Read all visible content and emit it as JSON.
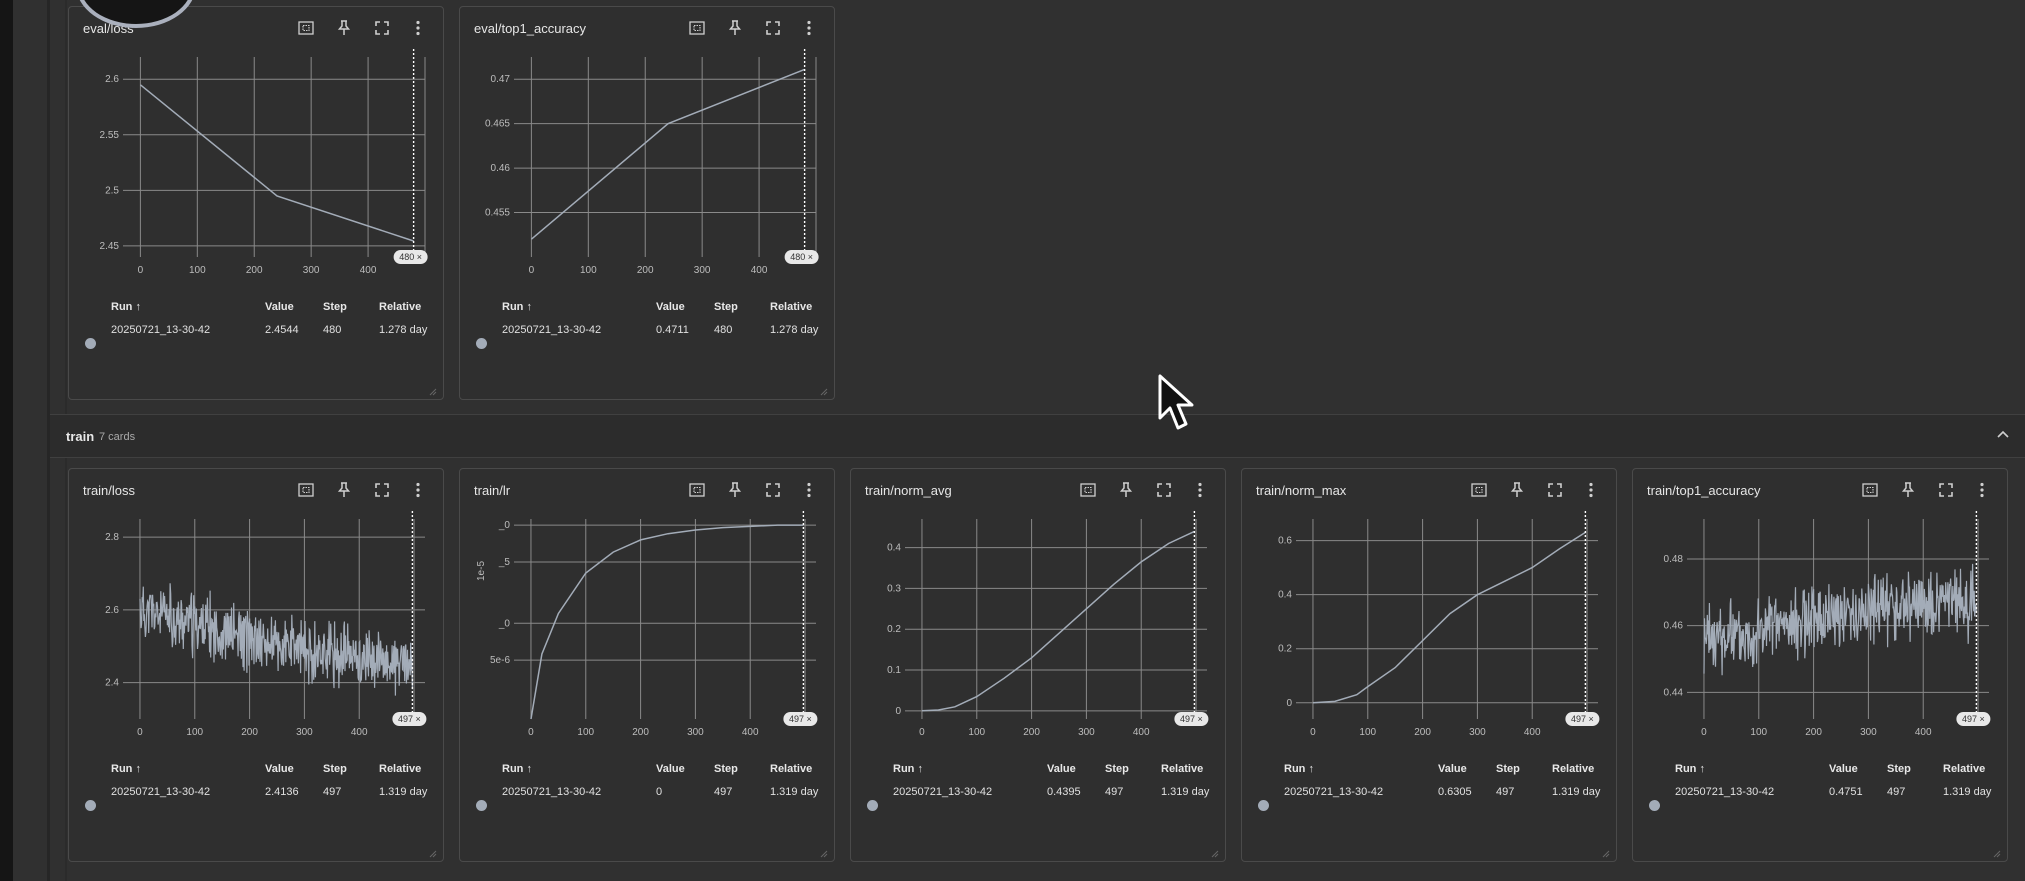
{
  "section_train": {
    "title": "train",
    "count": "7 cards"
  },
  "table_headers": {
    "run": "Run ↑",
    "value": "Value",
    "step": "Step",
    "relative": "Relative"
  },
  "cards": [
    {
      "title": "eval/loss",
      "xticks": [
        "0",
        "100",
        "200",
        "300",
        "400"
      ],
      "yticks": [
        "2.6",
        "2.55",
        "2.5",
        "2.45"
      ],
      "badge": "480 ×",
      "row": {
        "run": "20250721_13-30-42",
        "value": "2.4544",
        "step": "480",
        "relative": "1.278 day"
      },
      "chart_data": {
        "type": "line",
        "x": [
          0,
          240,
          480
        ],
        "y": [
          2.595,
          2.495,
          2.4544
        ],
        "ylim": [
          2.44,
          2.62
        ],
        "xlim": [
          -20,
          500
        ],
        "ylabel": "",
        "xlabel": ""
      }
    },
    {
      "title": "eval/top1_accuracy",
      "xticks": [
        "0",
        "100",
        "200",
        "300",
        "400"
      ],
      "yticks": [
        "0.47",
        "0.465",
        "0.46",
        "0.455"
      ],
      "badge": "480 ×",
      "row": {
        "run": "20250721_13-30-42",
        "value": "0.4711",
        "step": "480",
        "relative": "1.278 day"
      },
      "chart_data": {
        "type": "line",
        "x": [
          0,
          240,
          480
        ],
        "y": [
          0.452,
          0.465,
          0.4711
        ],
        "ylim": [
          0.45,
          0.4725
        ],
        "xlim": [
          -20,
          500
        ],
        "ylabel": "",
        "xlabel": ""
      }
    },
    {
      "title": "train/loss",
      "xticks": [
        "0",
        "100",
        "200",
        "300",
        "400"
      ],
      "yticks": [
        "2.8",
        "2.6",
        "2.4"
      ],
      "badge": "497 ×",
      "row": {
        "run": "20250721_13-30-42",
        "value": "2.4136",
        "step": "497",
        "relative": "1.319 day"
      },
      "chart_data": {
        "type": "line",
        "noisy": true,
        "x_start": 0,
        "x_end": 497,
        "trend": [
          [
            0,
            2.6
          ],
          [
            250,
            2.5
          ],
          [
            497,
            2.45
          ]
        ],
        "noise": 0.09,
        "seed": 11,
        "ylim": [
          2.3,
          2.85
        ],
        "xlim": [
          -20,
          520
        ],
        "ylabel": "",
        "xlabel": ""
      }
    },
    {
      "title": "train/lr",
      "xticks": [
        "0",
        "100",
        "200",
        "300",
        "400"
      ],
      "yticks": [
        "_0",
        "_5",
        "_0",
        "5e-6"
      ],
      "ylabel": "1e-5",
      "badge": "497 ×",
      "row": {
        "run": "20250721_13-30-42",
        "value": "0",
        "step": "497",
        "relative": "1.319 day"
      },
      "chart_data": {
        "type": "line",
        "curve": "saturating",
        "x": [
          0,
          20,
          50,
          100,
          150,
          200,
          250,
          300,
          350,
          400,
          450,
          497
        ],
        "y": [
          2e-07,
          5.5e-06,
          8.8e-06,
          1.21e-05,
          1.38e-05,
          1.48e-05,
          1.53e-05,
          1.56e-05,
          1.58e-05,
          1.59e-05,
          1.6e-05,
          1.6e-05
        ],
        "ylim": [
          2e-07,
          1.65e-05
        ],
        "xlim": [
          -20,
          520
        ],
        "ytick_values": [
          1.6e-05,
          1.3e-05,
          8e-06,
          5e-06
        ],
        "xlabel": ""
      }
    },
    {
      "title": "train/norm_avg",
      "xticks": [
        "0",
        "100",
        "200",
        "300",
        "400"
      ],
      "yticks": [
        "0.4",
        "0.3",
        "0.2",
        "0.1",
        "0"
      ],
      "badge": "497 ×",
      "row": {
        "run": "20250721_13-30-42",
        "value": "0.4395",
        "step": "497",
        "relative": "1.319 day"
      },
      "chart_data": {
        "type": "line",
        "x": [
          0,
          30,
          60,
          100,
          150,
          200,
          250,
          300,
          350,
          400,
          450,
          497
        ],
        "y": [
          0,
          0.002,
          0.01,
          0.035,
          0.08,
          0.13,
          0.19,
          0.25,
          0.31,
          0.365,
          0.41,
          0.4395
        ],
        "ylim": [
          -0.02,
          0.47
        ],
        "xlim": [
          -20,
          520
        ],
        "ylabel": "",
        "xlabel": ""
      }
    },
    {
      "title": "train/norm_max",
      "xticks": [
        "0",
        "100",
        "200",
        "300",
        "400"
      ],
      "yticks": [
        "0.6",
        "0.4",
        "0.2",
        "0"
      ],
      "badge": "497 ×",
      "row": {
        "run": "20250721_13-30-42",
        "value": "0.6305",
        "step": "497",
        "relative": "1.319 day"
      },
      "chart_data": {
        "type": "line",
        "x": [
          0,
          40,
          80,
          100,
          150,
          200,
          250,
          300,
          350,
          400,
          450,
          497
        ],
        "y": [
          0,
          0.005,
          0.03,
          0.06,
          0.13,
          0.23,
          0.33,
          0.4,
          0.45,
          0.5,
          0.57,
          0.6305
        ],
        "ylim": [
          -0.06,
          0.68
        ],
        "xlim": [
          -20,
          520
        ],
        "ylabel": "",
        "xlabel": ""
      }
    },
    {
      "title": "train/top1_accuracy",
      "xticks": [
        "0",
        "100",
        "200",
        "300",
        "400"
      ],
      "yticks": [
        "0.48",
        "0.46",
        "0.44"
      ],
      "badge": "497 ×",
      "row": {
        "run": "20250721_13-30-42",
        "value": "0.4751",
        "step": "497",
        "relative": "1.319 day"
      },
      "chart_data": {
        "type": "line",
        "noisy": true,
        "x_start": 0,
        "x_end": 497,
        "trend": [
          [
            0,
            0.455
          ],
          [
            250,
            0.464
          ],
          [
            497,
            0.467
          ]
        ],
        "noise": 0.011,
        "seed": 23,
        "ylim": [
          0.432,
          0.492
        ],
        "xlim": [
          -20,
          520
        ],
        "ylabel": "",
        "xlabel": ""
      }
    }
  ]
}
